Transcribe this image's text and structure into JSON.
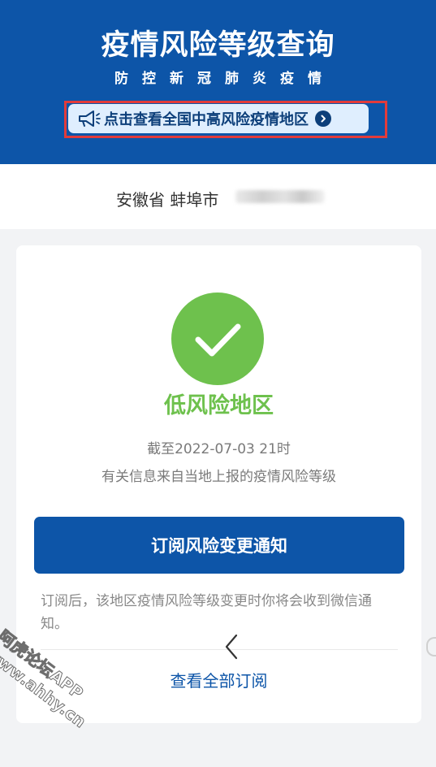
{
  "header": {
    "title": "疫情风险等级查询",
    "subtitle": "防控新冠肺炎疫情",
    "notice_text": "点击查看全国中高风险疫情地区",
    "megaphone_icon": "megaphone-icon",
    "chevron_icon": "chevron-right-circle-icon"
  },
  "location": {
    "text": "安徽省 蚌埠市"
  },
  "result": {
    "status_icon": "check-icon",
    "risk_level": "低风险地区",
    "as_of": "截至2022-07-03 21时",
    "source": "有关信息来自当地上报的疫情风险等级"
  },
  "subscribe": {
    "button_label": "订阅风险变更通知",
    "note": "订阅后，该地区疫情风险等级变更时你将会收到微信通知。",
    "view_all": "查看全部订阅"
  },
  "watermark": {
    "line1": "阿虎论坛APP",
    "line2": "www.ahhy.cn"
  },
  "colors": {
    "header_bg": "#0d55a8",
    "low_risk_green": "#6ec14d",
    "highlight_border": "#e23b3b"
  }
}
